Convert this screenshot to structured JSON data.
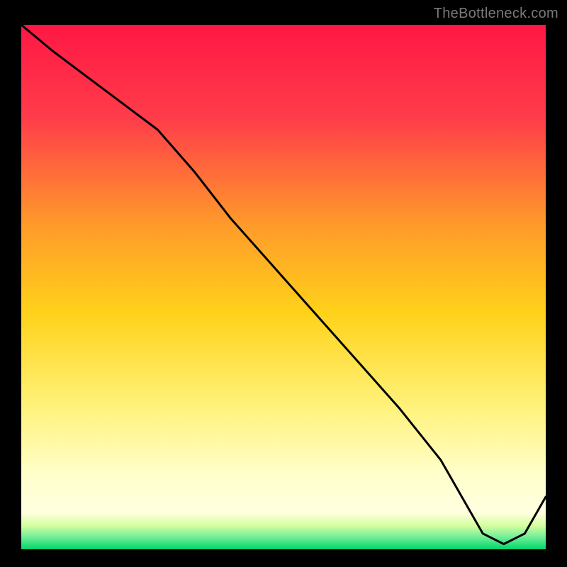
{
  "watermark": "TheBottleneck.com",
  "annotation_label": "",
  "colors": {
    "top": "#ff1744",
    "upper_mid": "#ff7a2a",
    "mid": "#ffd21a",
    "lower_mid": "#fff176",
    "pale": "#ffffcc",
    "bottom_band": "#00e676",
    "line": "#000000",
    "background": "#000000"
  },
  "chart_data": {
    "type": "line",
    "title": "",
    "xlabel": "",
    "ylabel": "",
    "xlim": [
      0,
      100
    ],
    "ylim": [
      0,
      100
    ],
    "x": [
      0,
      6,
      26,
      33,
      40,
      48,
      56,
      64,
      72,
      80,
      84,
      88,
      92,
      96,
      100
    ],
    "values": [
      100,
      95,
      80,
      72,
      63,
      54,
      45,
      36,
      27,
      17,
      10,
      3,
      1,
      3,
      10
    ],
    "annotations": [
      {
        "x": 86,
        "y": 4,
        "text": ""
      }
    ],
    "gradient_stops": [
      {
        "offset": 0.0,
        "color": "#ff1744"
      },
      {
        "offset": 0.18,
        "color": "#ff3d4a"
      },
      {
        "offset": 0.38,
        "color": "#ff9a2a"
      },
      {
        "offset": 0.55,
        "color": "#ffd21a"
      },
      {
        "offset": 0.72,
        "color": "#fff176"
      },
      {
        "offset": 0.86,
        "color": "#ffffcc"
      },
      {
        "offset": 0.93,
        "color": "#ffffe0"
      },
      {
        "offset": 0.955,
        "color": "#d4ff9e"
      },
      {
        "offset": 0.975,
        "color": "#7aef9a"
      },
      {
        "offset": 1.0,
        "color": "#00d66a"
      }
    ]
  }
}
